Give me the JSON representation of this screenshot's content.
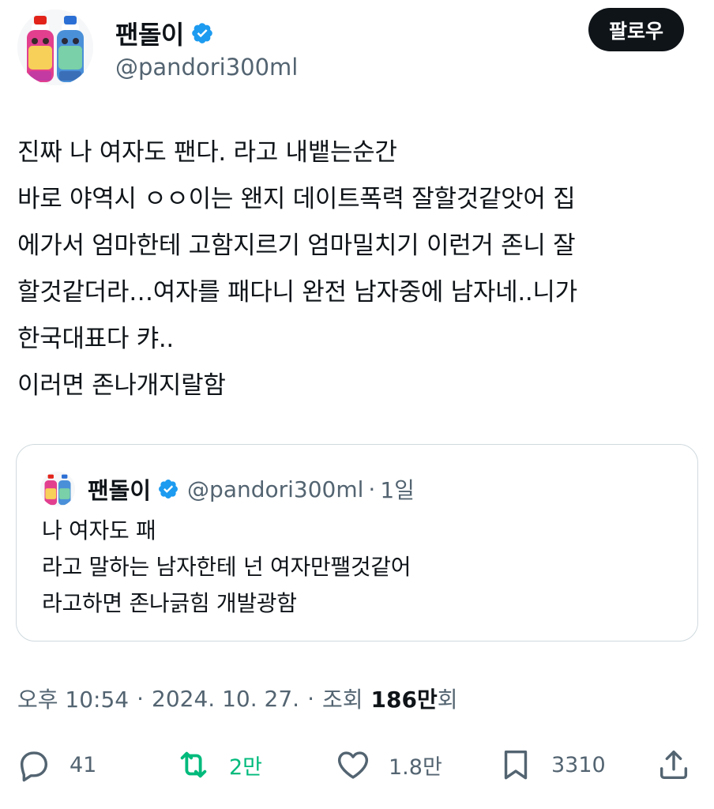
{
  "author": {
    "display_name": "팬돌이",
    "handle": "@pandori300ml",
    "verified": true
  },
  "follow_button": {
    "label": "팔로우"
  },
  "tweet": {
    "lines": [
      "진짜 나 여자도 팬다. 라고 내뱉는순간",
      "바로 야역시 ㅇㅇ이는 왠지 데이트폭력 잘할것같앗어 집",
      "에가서 엄마한테 고함지르기 엄마밀치기 이런거 존니 잘",
      "할것같더라…여자를 패다니 완전 남자중에 남자네..니가",
      "한국대표다 캬..",
      "이러면 존나개지랄함"
    ]
  },
  "quote": {
    "display_name": "팬돌이",
    "handle": "@pandori300ml",
    "separator": "·",
    "time": "1일",
    "lines": [
      "나 여자도 패",
      "라고 말하는 남자한테 넌 여자만팰것같어",
      "라고하면 존나긁힘 개발광함"
    ]
  },
  "meta": {
    "time": "오후 10:54",
    "date": "2024. 10. 27.",
    "separator": "·",
    "views_label": "조회",
    "views_count": "186만",
    "views_suffix": "회"
  },
  "actions": {
    "reply": {
      "icon": "reply-icon",
      "count": "41"
    },
    "retweet": {
      "icon": "retweet-icon",
      "count": "2만",
      "color": "#00ba7c"
    },
    "like": {
      "icon": "heart-icon",
      "count": "1.8만"
    },
    "bookmark": {
      "icon": "bookmark-icon",
      "count": "3310"
    },
    "share": {
      "icon": "share-icon"
    }
  },
  "colors": {
    "text": "#0f1419",
    "secondary": "#536471",
    "verified": "#1d9bf0",
    "border": "#cfd9de",
    "retweet_active": "#00ba7c"
  }
}
